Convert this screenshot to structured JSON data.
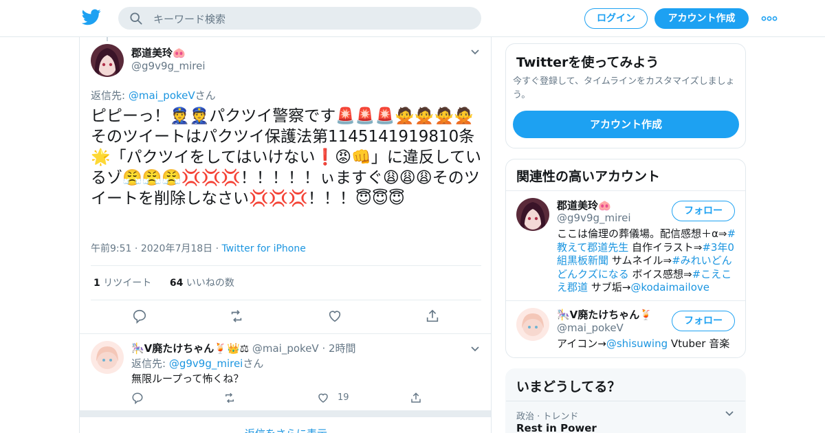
{
  "topbar": {
    "search_placeholder": "キーワード検索",
    "login_label": "ログイン",
    "signup_label": "アカウント作成",
    "brand_color": "#1da1f2"
  },
  "tweet": {
    "display_name": "郡道美玲🐽",
    "handle": "@g9v9g_mirei",
    "reply_prefix": "返信先: ",
    "reply_to": "@mai_pokeV",
    "reply_suffix": "さん",
    "text": "ピピーっ！👮👮パクツイ警察です🚨🚨🚨🙅🙅🙅🙅そのツイートはパクツイ保護法第1145141919810条🌟「パクツイをしてはいけない❗😡👊」に違反しているゾ😤😤😤💢💢💢！！！！！ぃますぐ😩😩😩そのツイートを削除しなさい💢💢💢！！！😇😇😇",
    "time": "午前9:51",
    "date": "2020年7月18日",
    "source": "Twitter for iPhone",
    "retweet_count": "1",
    "retweet_label": "リツイート",
    "like_count": "64",
    "like_label": "いいねの数"
  },
  "reply": {
    "display_name": "🎠V廃たけちゃん🍹👑⚖",
    "handle": "@mai_pokeV",
    "time": "2時間",
    "reply_prefix": "返信先: ",
    "reply_to": "@g9v9g_mirei",
    "reply_suffix": "さん",
    "text": "無限ループって怖くね？",
    "like_count": "19"
  },
  "show_more": "返信をさらに表示",
  "sidebar": {
    "try_title": "Twitterを使ってみよう",
    "try_desc": "今すぐ登録して、タイムラインをカスタマイズしましょう。",
    "try_button": "アカウント作成",
    "related_title": "関連性の高いアカウント",
    "accounts": [
      {
        "name": "郡道美玲🐽",
        "handle": "@g9v9g_mirei",
        "follow": "フォロー",
        "bio_parts": [
          {
            "t": "ここは倫理の葬儀場。配信感想＋α⇒",
            "link": false
          },
          {
            "t": "#教えて郡道先生",
            "link": true
          },
          {
            "t": " 自作イラスト⇒",
            "link": false
          },
          {
            "t": "#3年0組黒板新聞",
            "link": true
          },
          {
            "t": " サムネイル⇒",
            "link": false
          },
          {
            "t": "#みれいどんどんクズになる",
            "link": true
          },
          {
            "t": " ボイス感想⇒",
            "link": false
          },
          {
            "t": "#こえこえ郡道",
            "link": true
          },
          {
            "t": " サブ垢→",
            "link": false
          },
          {
            "t": "@kodaimailove",
            "link": true
          }
        ]
      },
      {
        "name": "🎠V廃たけちゃん🍹",
        "handle": "@mai_pokeV",
        "follow": "フォロー",
        "bio_parts": [
          {
            "t": "アイコン→",
            "link": false
          },
          {
            "t": "@shisuwing",
            "link": true
          },
          {
            "t": " Vtuber 音楽",
            "link": false
          }
        ]
      }
    ],
    "trends_title": "いまどうしてる？",
    "trend_category": "政治 · トレンド",
    "trend_name": "Rest in Power"
  }
}
